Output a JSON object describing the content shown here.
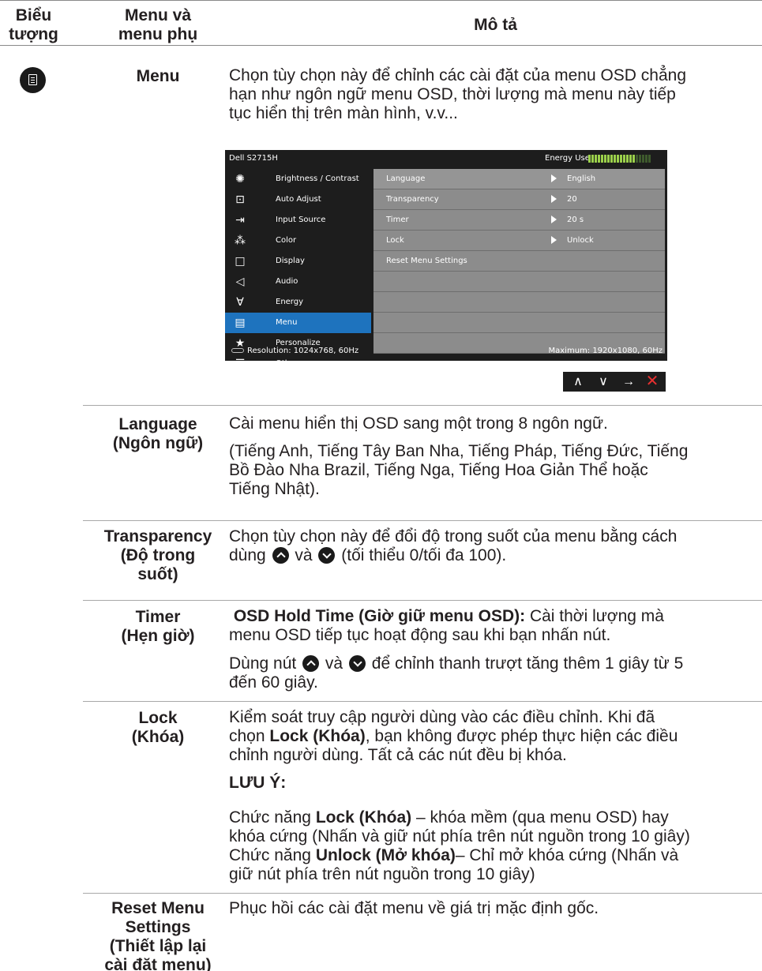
{
  "header": {
    "col_icon": "Biểu tượng",
    "col_menu_l1": "Menu và",
    "col_menu_l2": "menu phụ",
    "col_desc": "Mô tả"
  },
  "icon": "menu-icon",
  "menu_row": {
    "name": "Menu",
    "desc": [
      "Chọn tùy chọn này để chỉnh các cài đặt của menu OSD chẳng",
      "hạn như ngôn ngữ menu OSD, thời lượng mà menu này tiếp",
      "tục hiển thị trên màn hình, v.v..."
    ]
  },
  "osd": {
    "title": "Dell S2715H",
    "energy_label": "Energy Use",
    "energy_level": 0.75,
    "left_items": [
      {
        "label": "Brightness / Contrast",
        "icon": "brightness-icon"
      },
      {
        "label": "Auto Adjust",
        "icon": "auto-adjust-icon"
      },
      {
        "label": "Input Source",
        "icon": "input-source-icon"
      },
      {
        "label": "Color",
        "icon": "color-icon"
      },
      {
        "label": "Display",
        "icon": "display-icon"
      },
      {
        "label": "Audio",
        "icon": "audio-icon"
      },
      {
        "label": "Energy",
        "icon": "energy-icon"
      },
      {
        "label": "Menu",
        "icon": "menu-icon"
      },
      {
        "label": "Personalize",
        "icon": "star-icon"
      },
      {
        "label": "Others",
        "icon": "others-icon"
      }
    ],
    "right_rows": [
      {
        "key": "Language",
        "value": "English"
      },
      {
        "key": "Transparency",
        "value": "20"
      },
      {
        "key": "Timer",
        "value": "20 s"
      },
      {
        "key": "Lock",
        "value": "Unlock"
      },
      {
        "key": "Reset Menu Settings",
        "value": ""
      }
    ],
    "resolution": "Resolution: 1024x768, 60Hz",
    "maximum": "Maximum: 1920x1080, 60Hz"
  },
  "nav": [
    "up-icon",
    "down-icon",
    "enter-icon",
    "close-icon"
  ],
  "rows": {
    "language": {
      "name_l1": "Language",
      "name_l2": "(Ngôn ngữ)",
      "desc1": "Cài menu hiển thị OSD sang một trong 8 ngôn ngữ.",
      "desc2": [
        "(Tiếng Anh, Tiếng Tây Ban Nha, Tiếng Pháp, Tiếng Đức, Tiếng",
        "Bồ Đào Nha Brazil, Tiếng Nga, Tiếng Hoa Giản Thể hoặc",
        "Tiếng Nhật)."
      ]
    },
    "transparency": {
      "name_l1": "Transparency",
      "name_l2": "(Độ trong",
      "name_l3": "suốt)",
      "desc_l1": "Chọn tùy chọn này để đổi độ trong suốt của menu bằng cách",
      "desc_l2a": "dùng",
      "desc_l2b": "và",
      "desc_l2c": "(tối thiểu 0/tối đa 100)."
    },
    "timer": {
      "name_l1": "Timer",
      "name_l2": "(Hẹn giờ)",
      "bold": "OSD Hold Time (Giờ giữ menu OSD):",
      "desc_l1": "Cài thời lượng mà",
      "desc_l2": "menu OSD tiếp tục hoạt động sau khi bạn nhấn nút.",
      "desc_l3a": "Dùng nút",
      "desc_l3b": "và",
      "desc_l3c": "để chỉnh thanh trượt tăng thêm 1 giây từ 5",
      "desc_l4": "đến 60 giây."
    },
    "lock": {
      "name_l1": "Lock",
      "name_l2": "(Khóa)",
      "p1_l1": "Kiểm soát truy cập người dùng vào các điều chỉnh. Khi đã",
      "p1_l2a": "chọn",
      "p1_l2b": "Lock (Khóa)",
      "p1_l2c": ", bạn không được phép thực hiện các điều",
      "p1_l3": "chỉnh người dùng. Tất cả các nút đều bị khóa.",
      "note": "LƯU Ý:",
      "p2_l1a": "Chức năng",
      "p2_l1b": "Lock (Khóa)",
      "p2_l1c": "– khóa mềm (qua menu OSD) hay",
      "p2_l2": "khóa cứng (Nhấn và giữ nút phía trên nút nguồn trong 10 giây)",
      "p2_l3a": "Chức năng",
      "p2_l3b": "Unlock (Mở khóa)",
      "p2_l3c": "– Chỉ mở khóa cứng (Nhấn và",
      "p2_l4": "giữ nút phía trên nút nguồn trong 10 giây)"
    },
    "reset": {
      "name_l1": "Reset Menu",
      "name_l2": "Settings",
      "name_l3": "(Thiết lập lại",
      "name_l4": "cài đặt menu)",
      "desc": "Phục hồi các cài đặt menu về giá trị mặc định gốc."
    }
  }
}
